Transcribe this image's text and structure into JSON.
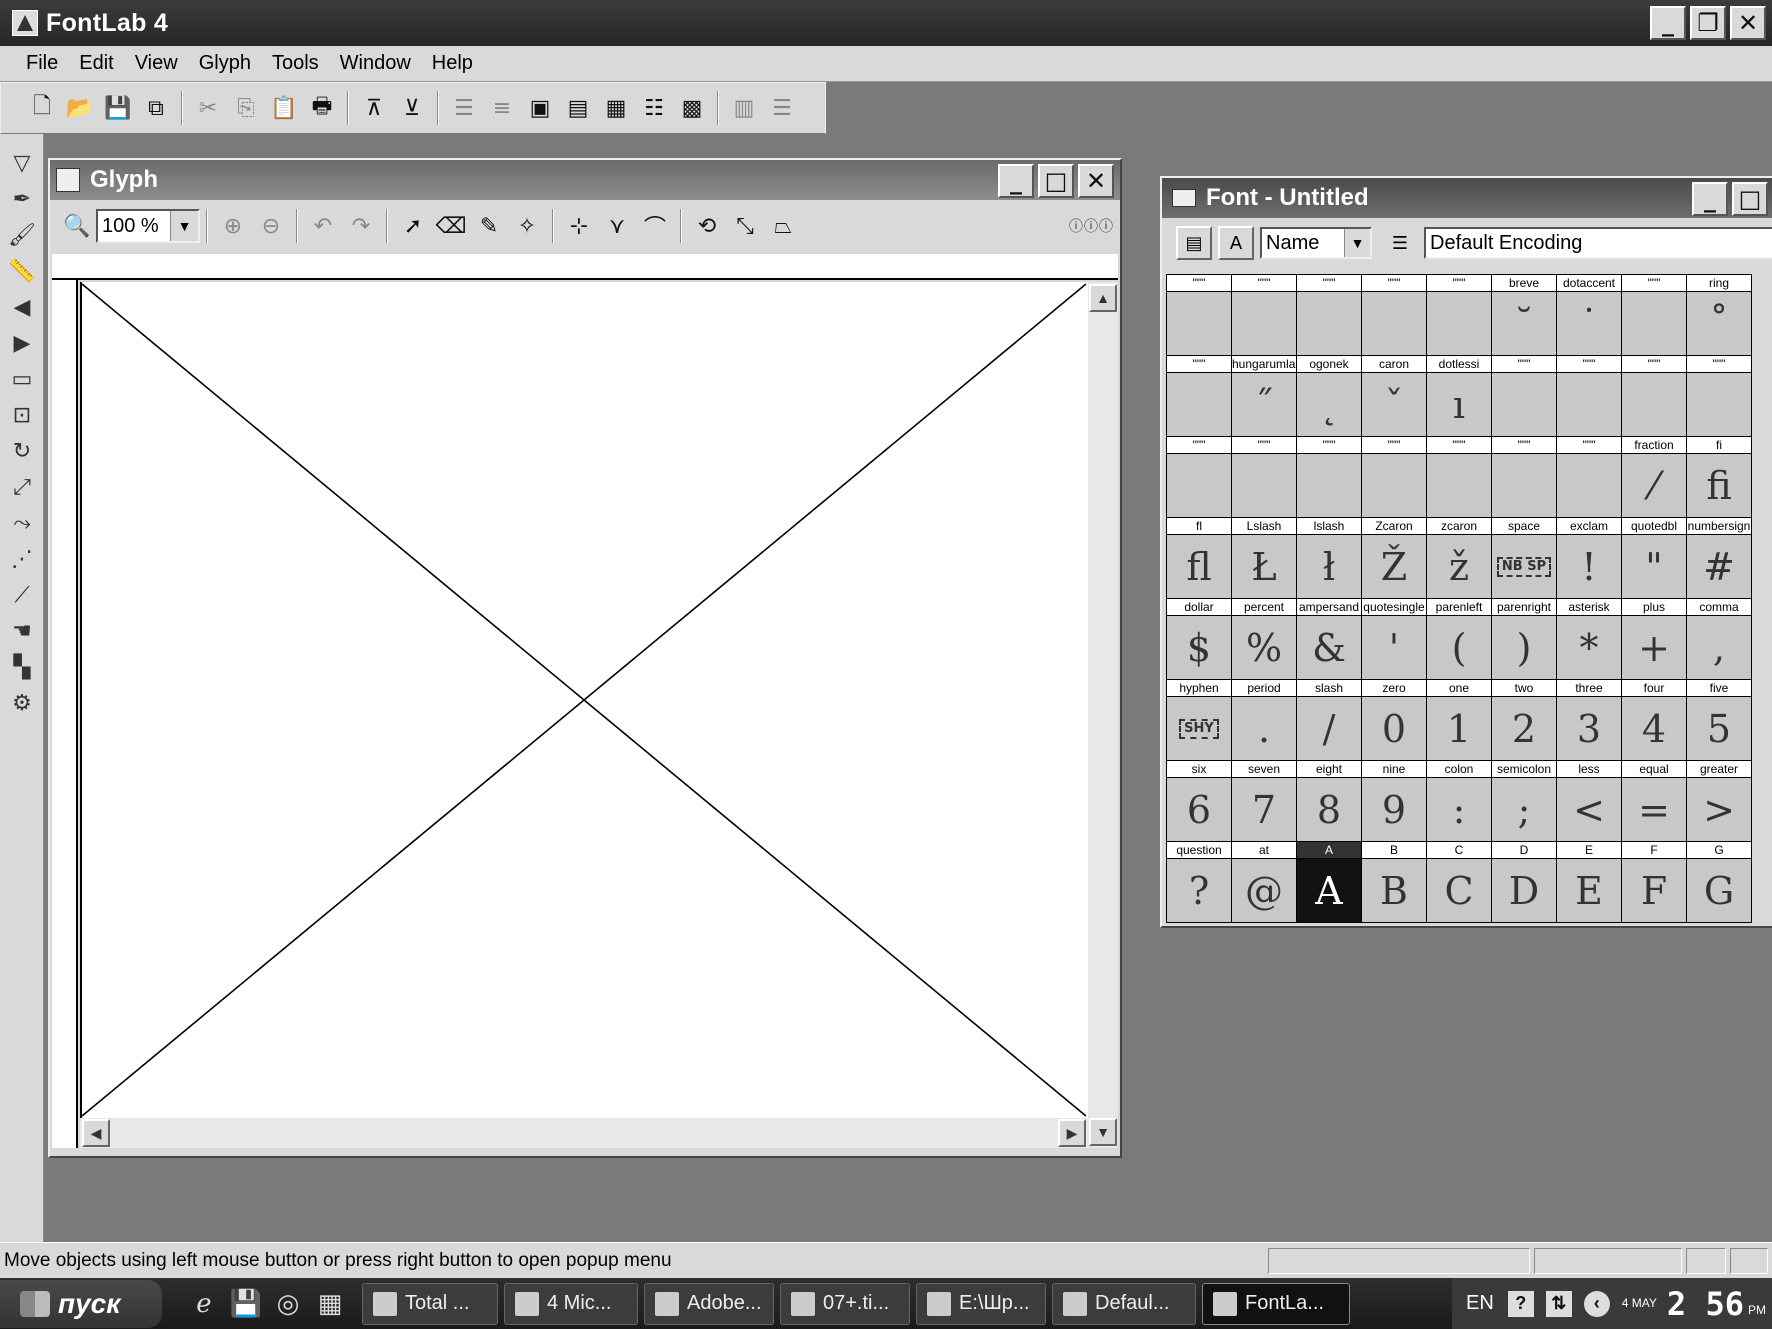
{
  "app": {
    "title": "FontLab 4"
  },
  "menu": [
    "File",
    "Edit",
    "View",
    "Glyph",
    "Tools",
    "Window",
    "Help"
  ],
  "toolbar_icons": [
    "new-file-icon",
    "open-folder-icon",
    "save-icon",
    "save-all-icon",
    "cut-icon",
    "copy-icon",
    "paste-icon",
    "print-icon",
    "metrics-icon",
    "kerning-icon",
    "font-info-icon",
    "align-icon",
    "opentype-icon",
    "classes-icon",
    "table-icon",
    "hints-icon",
    "grid-icon",
    "multiple-master-icon",
    "list-icon"
  ],
  "glyph_window": {
    "title": "Glyph",
    "zoom": "100 %"
  },
  "font_window": {
    "title": "Font - Untitled",
    "mode_select": "Name",
    "encoding": "Default Encoding",
    "cells": [
      {
        "name": "\"\"\"",
        "glyph": ""
      },
      {
        "name": "\"\"\"",
        "glyph": ""
      },
      {
        "name": "\"\"\"",
        "glyph": ""
      },
      {
        "name": "\"\"\"",
        "glyph": ""
      },
      {
        "name": "\"\"\"",
        "glyph": ""
      },
      {
        "name": "breve",
        "glyph": "˘"
      },
      {
        "name": "dotaccent",
        "glyph": "˙"
      },
      {
        "name": "\"\"\"",
        "glyph": ""
      },
      {
        "name": "ring",
        "glyph": "˚"
      },
      {
        "name": "\"\"\"",
        "glyph": ""
      },
      {
        "name": "hungarumlaut",
        "glyph": "˝"
      },
      {
        "name": "ogonek",
        "glyph": "˛"
      },
      {
        "name": "caron",
        "glyph": "ˇ"
      },
      {
        "name": "dotlessi",
        "glyph": "ı"
      },
      {
        "name": "\"\"\"",
        "glyph": ""
      },
      {
        "name": "\"\"\"",
        "glyph": ""
      },
      {
        "name": "\"\"\"",
        "glyph": ""
      },
      {
        "name": "\"\"\"",
        "glyph": ""
      },
      {
        "name": "\"\"\"",
        "glyph": ""
      },
      {
        "name": "\"\"\"",
        "glyph": ""
      },
      {
        "name": "\"\"\"",
        "glyph": ""
      },
      {
        "name": "\"\"\"",
        "glyph": ""
      },
      {
        "name": "\"\"\"",
        "glyph": ""
      },
      {
        "name": "\"\"\"",
        "glyph": ""
      },
      {
        "name": "\"\"\"",
        "glyph": ""
      },
      {
        "name": "fraction",
        "glyph": "⁄"
      },
      {
        "name": "fi",
        "glyph": "ﬁ"
      },
      {
        "name": "fl",
        "glyph": "ﬂ"
      },
      {
        "name": "Lslash",
        "glyph": "Ł"
      },
      {
        "name": "lslash",
        "glyph": "ł"
      },
      {
        "name": "Zcaron",
        "glyph": "Ž"
      },
      {
        "name": "zcaron",
        "glyph": "ž"
      },
      {
        "name": "space",
        "glyph": "NB SP",
        "boxed": true
      },
      {
        "name": "exclam",
        "glyph": "!"
      },
      {
        "name": "quotedbl",
        "glyph": "\""
      },
      {
        "name": "numbersign",
        "glyph": "#"
      },
      {
        "name": "dollar",
        "glyph": "$"
      },
      {
        "name": "percent",
        "glyph": "%"
      },
      {
        "name": "ampersand",
        "glyph": "&"
      },
      {
        "name": "quotesingle",
        "glyph": "'"
      },
      {
        "name": "parenleft",
        "glyph": "("
      },
      {
        "name": "parenright",
        "glyph": ")"
      },
      {
        "name": "asterisk",
        "glyph": "*"
      },
      {
        "name": "plus",
        "glyph": "+"
      },
      {
        "name": "comma",
        "glyph": ","
      },
      {
        "name": "hyphen",
        "glyph": "SHY",
        "boxed": true
      },
      {
        "name": "period",
        "glyph": "."
      },
      {
        "name": "slash",
        "glyph": "/"
      },
      {
        "name": "zero",
        "glyph": "0"
      },
      {
        "name": "one",
        "glyph": "1"
      },
      {
        "name": "two",
        "glyph": "2"
      },
      {
        "name": "three",
        "glyph": "3"
      },
      {
        "name": "four",
        "glyph": "4"
      },
      {
        "name": "five",
        "glyph": "5"
      },
      {
        "name": "six",
        "glyph": "6"
      },
      {
        "name": "seven",
        "glyph": "7"
      },
      {
        "name": "eight",
        "glyph": "8"
      },
      {
        "name": "nine",
        "glyph": "9"
      },
      {
        "name": "colon",
        "glyph": ":"
      },
      {
        "name": "semicolon",
        "glyph": ";"
      },
      {
        "name": "less",
        "glyph": "<"
      },
      {
        "name": "equal",
        "glyph": "="
      },
      {
        "name": "greater",
        "glyph": ">"
      },
      {
        "name": "question",
        "glyph": "?"
      },
      {
        "name": "at",
        "glyph": "@"
      },
      {
        "name": "A",
        "glyph": "A",
        "selected": true
      },
      {
        "name": "B",
        "glyph": "B"
      },
      {
        "name": "C",
        "glyph": "C"
      },
      {
        "name": "D",
        "glyph": "D"
      },
      {
        "name": "E",
        "glyph": "E"
      },
      {
        "name": "F",
        "glyph": "F"
      },
      {
        "name": "G",
        "glyph": "G"
      }
    ]
  },
  "status": {
    "text": "Move objects using left mouse button or press right button to open popup menu"
  },
  "taskbar": {
    "start": "пуск",
    "tasks": [
      "Total ...",
      "4 Mic...",
      "Adobe...",
      "07+.ti...",
      "E:\\Шр...",
      "Defaul...",
      "FontLa..."
    ],
    "lang": "EN",
    "date": "4 MAY",
    "time": "2 56",
    "ampm": "PM"
  }
}
